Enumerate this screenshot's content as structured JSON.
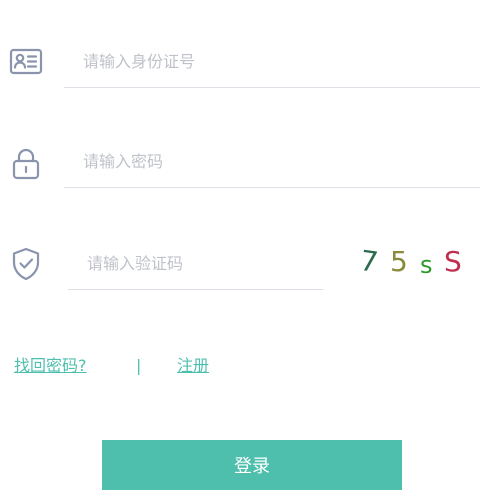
{
  "form": {
    "id_field": {
      "placeholder": "请输入身份证号",
      "value": ""
    },
    "password_field": {
      "placeholder": "请输入密码",
      "value": ""
    },
    "captcha_field": {
      "placeholder": "请输入验证码",
      "value": ""
    },
    "captcha": {
      "chars": [
        {
          "text": "7",
          "color": "#2e6b4f"
        },
        {
          "text": "5",
          "color": "#8a8a3a"
        },
        {
          "text": "s",
          "color": "#2a9a2a"
        },
        {
          "text": "S",
          "color": "#c0304e"
        }
      ]
    }
  },
  "links": {
    "forgot": "找回密码?",
    "separator": "|",
    "register": "注册"
  },
  "login_button": {
    "label": "登录"
  },
  "colors": {
    "accent": "#4ebfad",
    "icon": "#8a94ad",
    "divider": "#dcdfe6",
    "placeholder": "#bfc2c9"
  },
  "icons": {
    "id": "id-card-icon",
    "password": "lock-icon",
    "captcha": "shield-check-icon"
  }
}
